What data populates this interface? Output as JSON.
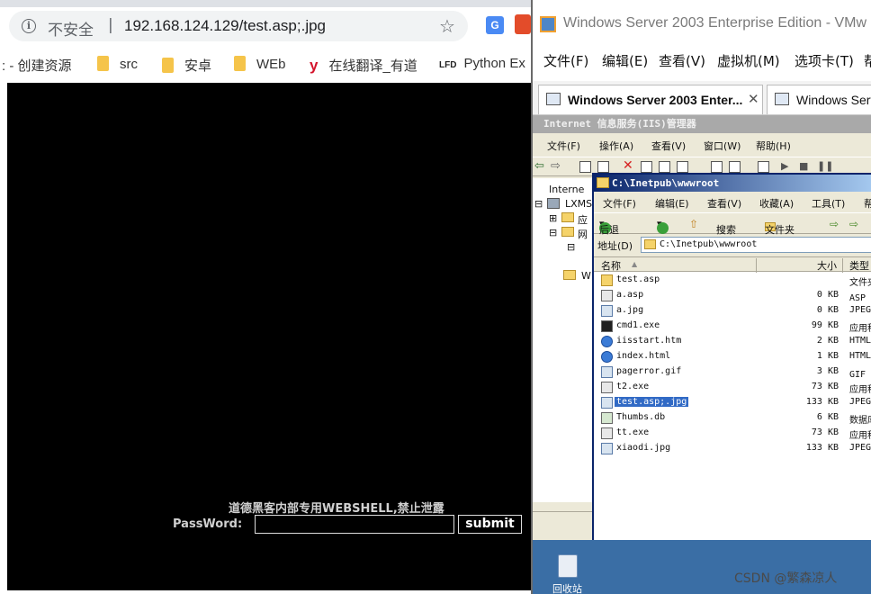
{
  "browser": {
    "security_label": "不安全",
    "separator": "|",
    "url": "192.168.124.129/test.asp;.jpg",
    "bookmarks": [
      {
        "label": ": - 创建资源",
        "icon": "none"
      },
      {
        "label": "src",
        "icon": "folder-icon"
      },
      {
        "label": "安卓",
        "icon": "folder-icon"
      },
      {
        "label": "WEb",
        "icon": "folder-icon"
      },
      {
        "label": "在线翻译_有道",
        "icon": "youdao-icon"
      },
      {
        "label": "Python Ex",
        "icon": "lfd-icon"
      }
    ]
  },
  "webshell": {
    "title": "道德黑客内部专用WEBSHELL,禁止泄露",
    "password_label": "PassWord:",
    "password_value": "",
    "submit_label": "submit"
  },
  "vmware": {
    "title": "Windows Server 2003 Enterprise Edition - VMw",
    "menu": [
      "文件(F)",
      "编辑(E)",
      "查看(V)",
      "虚拟机(M)",
      "选项卡(T)",
      "帮"
    ],
    "tabs": [
      {
        "label": "Windows Server 2003 Enter...",
        "active": true
      },
      {
        "label": "Windows Serve",
        "active": false
      }
    ]
  },
  "iis": {
    "title": "Internet 信息服务(IIS)管理器",
    "menu": [
      "文件(F)",
      "操作(A)",
      "查看(V)",
      "窗口(W)",
      "帮助(H)"
    ],
    "tree": [
      "Interne",
      "LXMS",
      "应",
      "网",
      "W"
    ]
  },
  "explorer": {
    "title": "C:\\Inetpub\\wwwroot",
    "menu": [
      "文件(F)",
      "编辑(E)",
      "查看(V)",
      "收藏(A)",
      "工具(T)",
      "帮"
    ],
    "toolbar": {
      "back": "后退",
      "search": "搜索",
      "folders": "文件夹"
    },
    "address_label": "地址(D)",
    "address_value": "C:\\Inetpub\\wwwroot",
    "columns": {
      "name": "名称",
      "size": "大小",
      "type": "类型"
    },
    "files": [
      {
        "name": "test.asp",
        "size": "",
        "type": "文件夹",
        "icon": "folder",
        "selected": false
      },
      {
        "name": "a.asp",
        "size": "0 KB",
        "type": "ASP 文",
        "icon": "asp",
        "selected": false
      },
      {
        "name": "a.jpg",
        "size": "0 KB",
        "type": "JPEG",
        "icon": "img",
        "selected": false
      },
      {
        "name": "cmd1.exe",
        "size": "99 KB",
        "type": "应用程",
        "icon": "exe",
        "selected": false
      },
      {
        "name": "iisstart.htm",
        "size": "2 KB",
        "type": "HTML",
        "icon": "htm",
        "selected": false
      },
      {
        "name": "index.html",
        "size": "1 KB",
        "type": "HTML",
        "icon": "htm",
        "selected": false
      },
      {
        "name": "pagerror.gif",
        "size": "3 KB",
        "type": "GIF 图",
        "icon": "img",
        "selected": false
      },
      {
        "name": "t2.exe",
        "size": "73 KB",
        "type": "应用程",
        "icon": "asp",
        "selected": false
      },
      {
        "name": "test.asp;.jpg",
        "size": "133 KB",
        "type": "JPEG",
        "icon": "img",
        "selected": true
      },
      {
        "name": "Thumbs.db",
        "size": "6 KB",
        "type": "数据库",
        "icon": "db",
        "selected": false
      },
      {
        "name": "tt.exe",
        "size": "73 KB",
        "type": "应用程",
        "icon": "asp",
        "selected": false
      },
      {
        "name": "xiaodi.jpg",
        "size": "133 KB",
        "type": "JPEG",
        "icon": "img",
        "selected": false
      }
    ]
  },
  "desktop": {
    "recycle_bin_label": "回收站"
  },
  "watermark": "CSDN @繁森凉人"
}
